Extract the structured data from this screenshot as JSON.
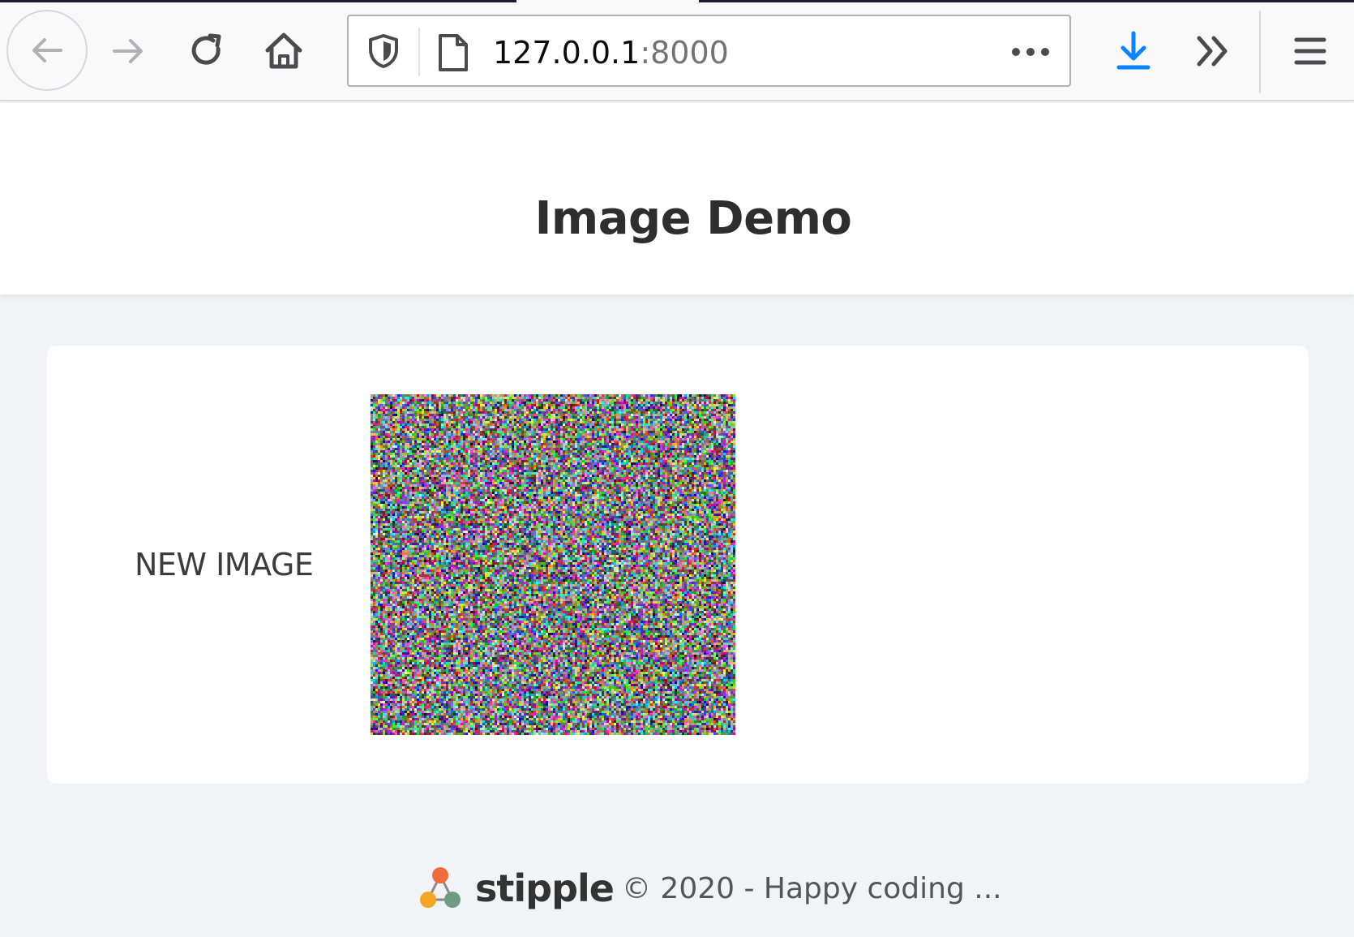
{
  "browser": {
    "url_host": "127.0.0.1",
    "url_port": ":8000",
    "icons": {
      "back": "back-arrow-icon",
      "forward": "forward-arrow-icon",
      "reload": "reload-icon",
      "home": "home-icon",
      "shield": "tracking-protection-shield-icon",
      "page": "page-icon",
      "more": "page-actions-ellipsis-icon",
      "download": "download-icon",
      "overflow": "overflow-chevrons-icon",
      "menu": "hamburger-menu-icon"
    },
    "colors": {
      "download_accent": "#0a84ff",
      "icon": "#4a4a4f",
      "icon_disabled": "#b1b1b3"
    }
  },
  "page": {
    "title": "Image Demo",
    "card": {
      "label": "NEW IMAGE",
      "image_kind": "random-color-noise"
    },
    "footer": {
      "brand": "stipple",
      "copyright": "© 2020 - Happy coding ...",
      "logo_colors": [
        "#f26b3a",
        "#f5a623",
        "#6f9c80"
      ]
    }
  }
}
